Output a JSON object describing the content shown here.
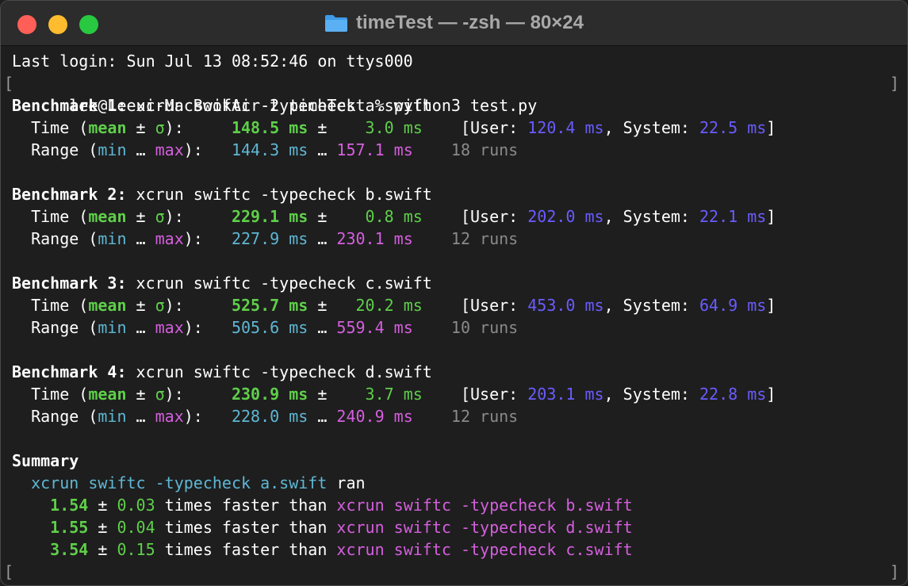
{
  "window": {
    "title": "timeTest — -zsh — 80×24",
    "folder_icon": "folder-icon"
  },
  "terminal": {
    "last_login": "Last login: Sun Jul 13 08:52:46 on ttys000",
    "prompt": "lee@Leeui-MacBookAir-2 timeTest % python3 test.py",
    "benchmarks": [
      {
        "label": "Benchmark 1:",
        "cmd": " xcrun swiftc -typecheck a.swift",
        "mean": "148.5 ms",
        "sigma": "  3.0 ms",
        "user": "120.4 ms",
        "system": "22.5 ms",
        "min": "144.3 ms",
        "max": "157.1 ms",
        "runs": "18 runs"
      },
      {
        "label": "Benchmark 2:",
        "cmd": " xcrun swiftc -typecheck b.swift",
        "mean": "229.1 ms",
        "sigma": "  0.8 ms",
        "user": "202.0 ms",
        "system": "22.1 ms",
        "min": "227.9 ms",
        "max": "230.1 ms",
        "runs": "12 runs"
      },
      {
        "label": "Benchmark 3:",
        "cmd": " xcrun swiftc -typecheck c.swift",
        "mean": "525.7 ms",
        "sigma": " 20.2 ms",
        "user": "453.0 ms",
        "system": "64.9 ms",
        "min": "505.6 ms",
        "max": "559.4 ms",
        "runs": "10 runs"
      },
      {
        "label": "Benchmark 4:",
        "cmd": " xcrun swiftc -typecheck d.swift",
        "mean": "230.9 ms",
        "sigma": "  3.7 ms",
        "user": "203.1 ms",
        "system": "22.8 ms",
        "min": "228.0 ms",
        "max": "240.9 ms",
        "runs": "12 runs"
      }
    ],
    "summary": {
      "title": "Summary",
      "fastest": "xcrun swiftc -typecheck a.swift",
      "ran": " ran",
      "comparisons": [
        {
          "factor": "1.54",
          "err": "0.03",
          "text": " times faster than ",
          "cmd": "xcrun swiftc -typecheck b.swift"
        },
        {
          "factor": "1.55",
          "err": "0.04",
          "text": " times faster than ",
          "cmd": "xcrun swiftc -typecheck d.swift"
        },
        {
          "factor": "3.54",
          "err": "0.15",
          "text": " times faster than ",
          "cmd": "xcrun swiftc -typecheck c.swift"
        }
      ]
    }
  }
}
